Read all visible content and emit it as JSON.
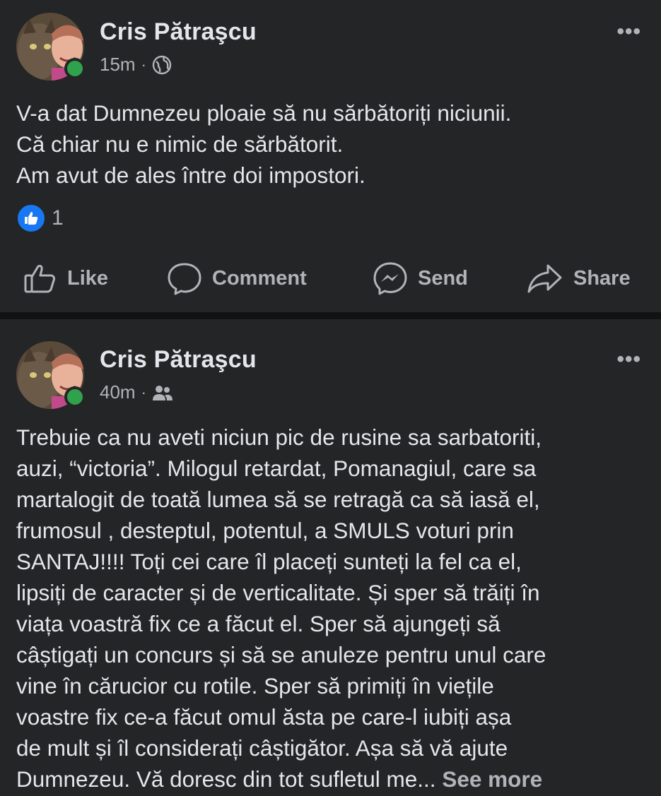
{
  "posts": [
    {
      "author": "Cris Pătraşcu",
      "time": "15m",
      "separator": "·",
      "audience_icon": "globe-icon",
      "lines": [
        "V-a dat Dumnezeu ploaie să nu sărbătoriți niciunii.",
        "Că chiar nu e nimic de sărbătorit.",
        "Am avut de ales între doi impostori."
      ],
      "reaction_count": "1",
      "actions": {
        "like": "Like",
        "comment": "Comment",
        "send": "Send",
        "share": "Share"
      }
    },
    {
      "author": "Cris Pătraşcu",
      "time": "40m",
      "separator": "·",
      "audience_icon": "friends-icon",
      "lines": [
        "Trebuie ca nu aveti niciun pic de rusine sa sarbatoriti,",
        "auzi, “victoria”. Milogul retardat, Pomanagiul,  care sa",
        "martalogit de toată lumea să se retragă ca să iasă el,",
        "frumosul , desteptul, potentul, a SMULS voturi prin",
        "SANTAJ!!!! Toți cei care îl placeți sunteți la fel ca el,",
        "lipsiți de caracter și de verticalitate. Și sper să trăiți în",
        "viața voastră fix ce a făcut el. Sper să ajungeți să",
        "câștigați un concurs și să se anuleze pentru unul care",
        "vine în cărucior cu rotile. Sper să primiți în viețile",
        "voastre fix ce-a făcut omul ăsta pe care-l iubiți așa",
        "de mult și îl considerați câștigător. Așa să vă ajute",
        "Dumnezeu. Vă doresc din tot sufletul me..."
      ],
      "see_more": "See more"
    }
  ],
  "colors": {
    "background": "#242526",
    "text": "#e4e6eb",
    "secondary_text": "#b0b3b8",
    "online": "#31a24c",
    "like_blue": "#1877f2"
  }
}
